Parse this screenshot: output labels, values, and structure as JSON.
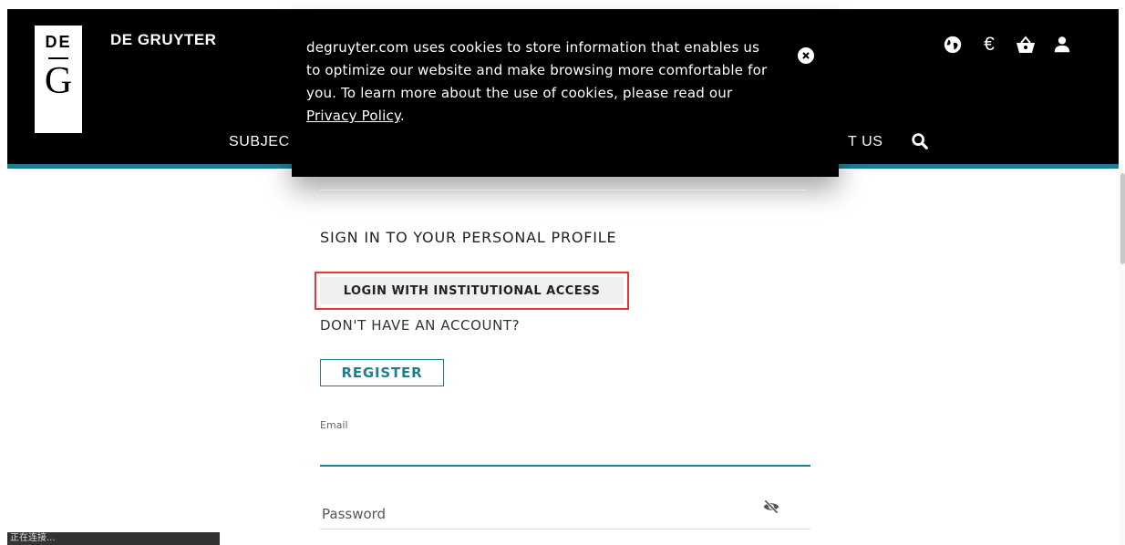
{
  "header": {
    "brand": "DE GRUYTER",
    "logo_top": "DE",
    "logo_letter": "G",
    "nav_left_fragment": "SUBJEC",
    "nav_right_fragment": "T US",
    "icons": [
      "globe-icon",
      "currency-icon",
      "basket-icon",
      "user-icon",
      "search-icon"
    ],
    "currency_symbol": "€",
    "accent_color": "#1f7d91"
  },
  "cookie_banner": {
    "text_before_link": "degruyter.com uses cookies to store information that enables us to optimize our website and make browsing more comfortable for you. To learn more about the use of cookies, please read our ",
    "link_text": "Privacy Policy",
    "text_after_link": "."
  },
  "login": {
    "heading": "SIGN IN TO YOUR PERSONAL PROFILE",
    "institutional_button": "LOGIN WITH INSTITUTIONAL ACCESS",
    "no_account": "DON'T HAVE AN ACCOUNT?",
    "register_button": "REGISTER",
    "email_label": "Email",
    "email_value": "",
    "password_placeholder": "Password"
  },
  "status_bar": {
    "text": "正在连接..."
  }
}
